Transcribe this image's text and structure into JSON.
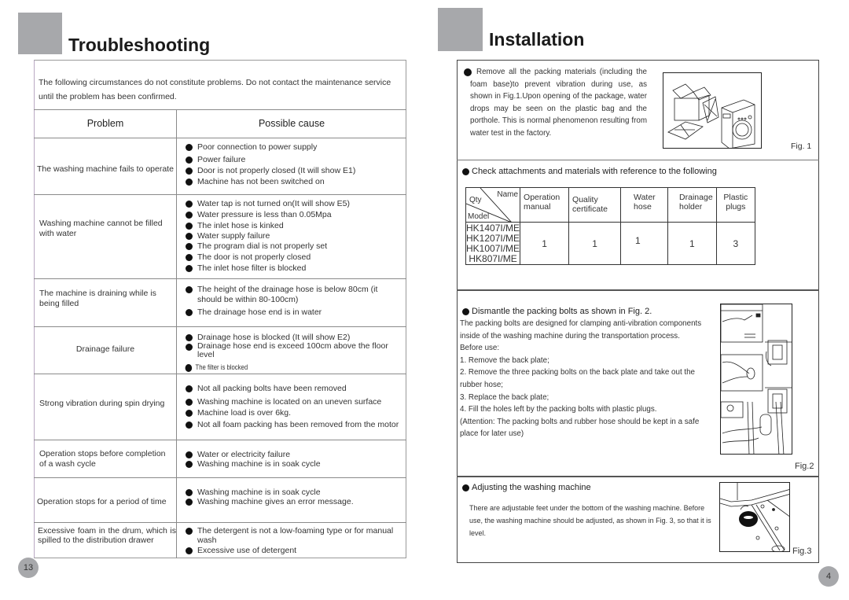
{
  "left_page": {
    "title": "Troubleshooting",
    "intro": "The following circumstances do not constitute problems. Do not contact the maintenance service until the problem has been confirmed.",
    "headers": {
      "problem": "Problem",
      "cause": "Possible cause"
    },
    "rows": [
      {
        "problem": "The washing machine fails to operate",
        "causes": [
          "Poor connection to power supply",
          "Power failure",
          "Door is not properly closed (It will show E1)",
          "Machine has not been switched on"
        ]
      },
      {
        "problem": "Washing machine cannot be filled with water",
        "causes": [
          "Water tap is not turned on(It will show E5)",
          "Water pressure is less than 0.05Mpa",
          "The inlet hose is kinked",
          "Water supply failure",
          "The program dial is not properly set",
          "The door is not properly closed",
          "The inlet hose filter is blocked"
        ]
      },
      {
        "problem": "The machine is draining while is being filled",
        "causes": [
          "The height of the drainage hose is below 80cm (it should be within 80-100cm)",
          "The drainage hose end is in water"
        ]
      },
      {
        "problem": "Drainage failure",
        "causes": [
          "Drainage hose is blocked (It will show E2)",
          "Drainage hose end is exceed 100cm above the floor level",
          "The filter is blocked"
        ]
      },
      {
        "problem": "Strong vibration during spin drying",
        "causes": [
          "Not all packing bolts have been removed",
          "Washing machine is located on an uneven surface",
          "Machine load is over 6kg.",
          "Not all foam packing has been removed from the motor"
        ]
      },
      {
        "problem": "Operation stops before completion of a wash cycle",
        "causes": [
          "Water or electricity failure",
          "Washing machine is in soak cycle"
        ]
      },
      {
        "problem": "Operation stops for a period of time",
        "causes": [
          "Washing machine is in soak cycle",
          "Washing machine gives an error message."
        ]
      },
      {
        "problem": "Excessive foam in the drum, which is spilled to the distribution drawer",
        "causes": [
          "The detergent is not a low-foaming type or for manual wash",
          "Excessive use of detergent"
        ]
      }
    ],
    "page_number": "13"
  },
  "right_page": {
    "title": "Installation",
    "section1": {
      "text": "Remove all the packing materials (including the foam base)to prevent vibration during use, as shown in Fig.1.Upon opening of the package, water drops may be seen on the plastic bag and the porthole. This is normal phenomenon resulting from water test in the factory.",
      "fig_label": "Fig. 1"
    },
    "section2": {
      "heading": "Check attachments and materials with reference to the following",
      "corner": {
        "name": "Name",
        "qty": "Qty",
        "model": "Model"
      },
      "columns": [
        "Operation manual",
        "Quality certificate",
        "Water hose",
        "Drainage holder",
        "Plastic plugs"
      ],
      "models": [
        "HK1407I/ME",
        "HK1207I/ME",
        "HK1007I/ME",
        "HK807I/ME"
      ],
      "quantities": [
        "1",
        "1",
        "1",
        "1",
        "3"
      ]
    },
    "section3": {
      "heading": "Dismantle the packing bolts as shown in Fig. 2.",
      "lines": [
        "The packing bolts are designed for clamping anti-vibration  components",
        "inside of the washing machine during the  transportation process.",
        "Before use:",
        "1. Remove the back plate;",
        "2. Remove the three packing bolts on the back plate and take  out the",
        "rubber hose;",
        "3. Replace the back plate;",
        "4. Fill the holes left by the packing bolts with plastic plugs.",
        "(Attention: The packing bolts and rubber hose should be kept in a  safe",
        "place for later use)"
      ],
      "fig_label": "Fig.2"
    },
    "section4": {
      "heading": "Adjusting the washing machine",
      "text": "There are adjustable feet under the bottom of the washing machine. Before use, the washing machine should be adjusted, as shown in Fig. 3, so that it is level.",
      "fig_label": "Fig.3"
    },
    "page_number": "4"
  }
}
